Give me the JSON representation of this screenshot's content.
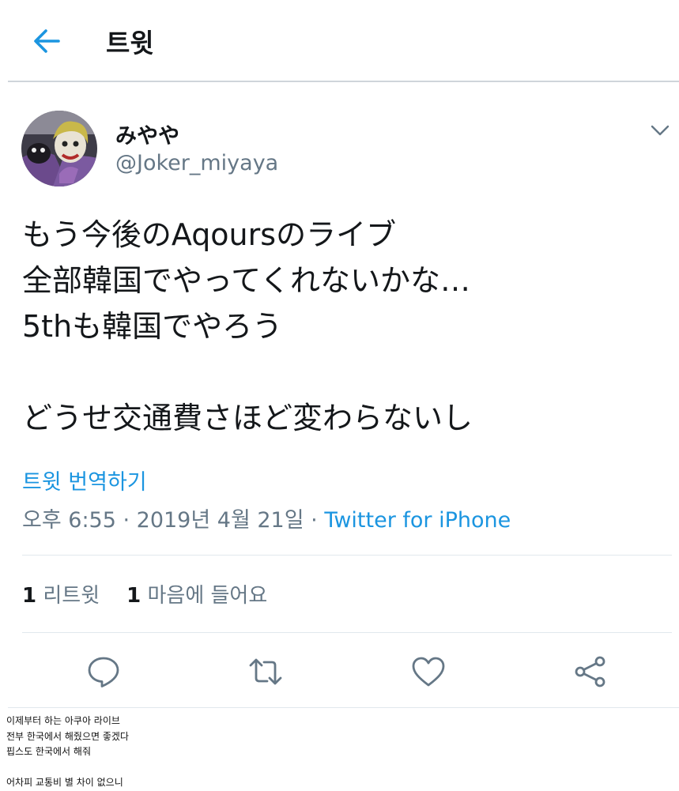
{
  "header": {
    "title": "트윗",
    "back_icon": "arrow-left-icon"
  },
  "author": {
    "display_name": "みやや",
    "handle": "@Joker_miyaya",
    "more_icon": "chevron-down-icon"
  },
  "tweet": {
    "text": "もう今後のAqoursのライブ\n全部韓国でやってくれないかな…\n5thも韓国でやろう\n\nどうせ交通費さほど変わらないし",
    "translate_label": "트윗 번역하기",
    "timestamp": "오후 6:55 · 2019년 4월 21일 · ",
    "source": "Twitter for iPhone"
  },
  "stats": {
    "retweets_count": "1",
    "retweets_label": "리트윗",
    "likes_count": "1",
    "likes_label": "마음에 들어요"
  },
  "actions": [
    "reply-icon",
    "retweet-icon",
    "like-icon",
    "share-icon"
  ],
  "colors": {
    "accent": "#1b95e0",
    "secondary_text": "#657786",
    "primary_text": "#14171a",
    "divider": "#e1e8ed"
  },
  "caption": "이제부터 하는 아쿠아 라이브\n전부 한국에서 해줬으면 좋겠다\n핍스도 한국에서 해줘\n\n어차피 교통비 별 차이 없으니"
}
